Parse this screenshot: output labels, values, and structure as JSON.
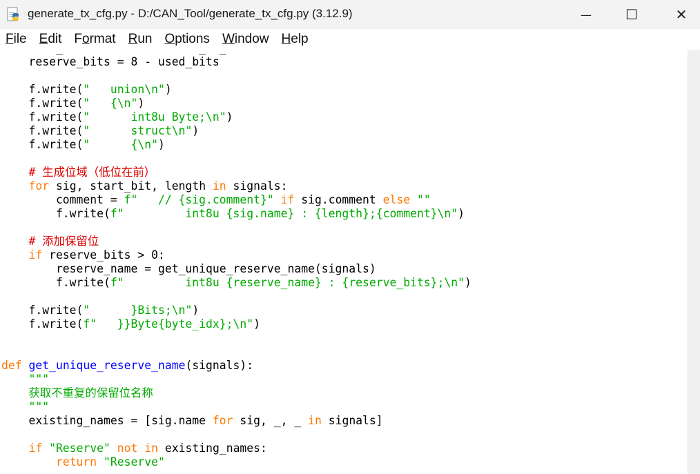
{
  "window": {
    "title": "generate_tx_cfg.py - D:/CAN_Tool/generate_tx_cfg.py (3.12.9)",
    "minimize_glyph": "—",
    "maximize_glyph": "☐",
    "close_glyph": "✕"
  },
  "menu": [
    {
      "u": "F",
      "rest": "ile"
    },
    {
      "u": "E",
      "rest": "dit"
    },
    {
      "pre": "F",
      "u": "o",
      "rest": "rmat"
    },
    {
      "u": "R",
      "rest": "un"
    },
    {
      "u": "O",
      "rest": "ptions"
    },
    {
      "u": "W",
      "rest": "indow"
    },
    {
      "u": "H",
      "rest": "elp"
    }
  ],
  "code_lines": [
    [
      {
        "t": "        _                    _  _                     ",
        "c": ""
      }
    ],
    [
      {
        "t": "    reserve_bits = 8 - used_bits",
        "c": ""
      }
    ],
    [
      {
        "t": "",
        "c": ""
      }
    ],
    [
      {
        "t": "    f.write(",
        "c": ""
      },
      {
        "t": "\"   union\\n\"",
        "c": "str"
      },
      {
        "t": ")",
        "c": ""
      }
    ],
    [
      {
        "t": "    f.write(",
        "c": ""
      },
      {
        "t": "\"   {\\n\"",
        "c": "str"
      },
      {
        "t": ")",
        "c": ""
      }
    ],
    [
      {
        "t": "    f.write(",
        "c": ""
      },
      {
        "t": "\"      int8u Byte;\\n\"",
        "c": "str"
      },
      {
        "t": ")",
        "c": ""
      }
    ],
    [
      {
        "t": "    f.write(",
        "c": ""
      },
      {
        "t": "\"      struct\\n\"",
        "c": "str"
      },
      {
        "t": ")",
        "c": ""
      }
    ],
    [
      {
        "t": "    f.write(",
        "c": ""
      },
      {
        "t": "\"      {\\n\"",
        "c": "str"
      },
      {
        "t": ")",
        "c": ""
      }
    ],
    [
      {
        "t": "",
        "c": ""
      }
    ],
    [
      {
        "t": "    # 生成位域（低位在前）",
        "c": "cm"
      }
    ],
    [
      {
        "t": "    ",
        "c": ""
      },
      {
        "t": "for",
        "c": "kw"
      },
      {
        "t": " sig, start_bit, length ",
        "c": ""
      },
      {
        "t": "in",
        "c": "kw"
      },
      {
        "t": " signals:",
        "c": ""
      }
    ],
    [
      {
        "t": "        comment = ",
        "c": ""
      },
      {
        "t": "f\"   // {sig.comment}\"",
        "c": "str"
      },
      {
        "t": " ",
        "c": ""
      },
      {
        "t": "if",
        "c": "kw"
      },
      {
        "t": " sig.comment ",
        "c": ""
      },
      {
        "t": "else",
        "c": "kw"
      },
      {
        "t": " ",
        "c": ""
      },
      {
        "t": "\"\"",
        "c": "str"
      }
    ],
    [
      {
        "t": "        f.write(",
        "c": ""
      },
      {
        "t": "f\"         int8u {sig.name} : {length};{comment}\\n\"",
        "c": "str"
      },
      {
        "t": ")",
        "c": ""
      }
    ],
    [
      {
        "t": "",
        "c": ""
      }
    ],
    [
      {
        "t": "    # 添加保留位",
        "c": "cm"
      }
    ],
    [
      {
        "t": "    ",
        "c": ""
      },
      {
        "t": "if",
        "c": "kw"
      },
      {
        "t": " reserve_bits > 0:",
        "c": ""
      }
    ],
    [
      {
        "t": "        reserve_name = get_unique_reserve_name(signals)",
        "c": ""
      }
    ],
    [
      {
        "t": "        f.write(",
        "c": ""
      },
      {
        "t": "f\"         int8u {reserve_name} : {reserve_bits};\\n\"",
        "c": "str"
      },
      {
        "t": ")",
        "c": ""
      }
    ],
    [
      {
        "t": "",
        "c": ""
      }
    ],
    [
      {
        "t": "    f.write(",
        "c": ""
      },
      {
        "t": "\"      }Bits;\\n\"",
        "c": "str"
      },
      {
        "t": ")",
        "c": ""
      }
    ],
    [
      {
        "t": "    f.write(",
        "c": ""
      },
      {
        "t": "f\"   }}Byte{byte_idx};\\n\"",
        "c": "str"
      },
      {
        "t": ")",
        "c": ""
      }
    ],
    [
      {
        "t": "",
        "c": ""
      }
    ],
    [
      {
        "t": "",
        "c": ""
      }
    ],
    [
      {
        "t": "def",
        "c": "kw"
      },
      {
        "t": " ",
        "c": ""
      },
      {
        "t": "get_unique_reserve_name",
        "c": "df"
      },
      {
        "t": "(signals):",
        "c": ""
      }
    ],
    [
      {
        "t": "    \"\"\"",
        "c": "str"
      }
    ],
    [
      {
        "t": "    获取不重复的保留位名称",
        "c": "str"
      }
    ],
    [
      {
        "t": "    \"\"\"",
        "c": "str"
      }
    ],
    [
      {
        "t": "    existing_names = [sig.name ",
        "c": ""
      },
      {
        "t": "for",
        "c": "kw"
      },
      {
        "t": " sig, _, _ ",
        "c": ""
      },
      {
        "t": "in",
        "c": "kw"
      },
      {
        "t": " signals]",
        "c": ""
      }
    ],
    [
      {
        "t": "",
        "c": ""
      }
    ],
    [
      {
        "t": "    ",
        "c": ""
      },
      {
        "t": "if",
        "c": "kw"
      },
      {
        "t": " ",
        "c": ""
      },
      {
        "t": "\"Reserve\"",
        "c": "str"
      },
      {
        "t": " ",
        "c": ""
      },
      {
        "t": "not in",
        "c": "kw"
      },
      {
        "t": " existing_names:",
        "c": ""
      }
    ],
    [
      {
        "t": "        ",
        "c": ""
      },
      {
        "t": "return",
        "c": "kw"
      },
      {
        "t": " ",
        "c": ""
      },
      {
        "t": "\"Reserve\"",
        "c": "str"
      }
    ]
  ]
}
